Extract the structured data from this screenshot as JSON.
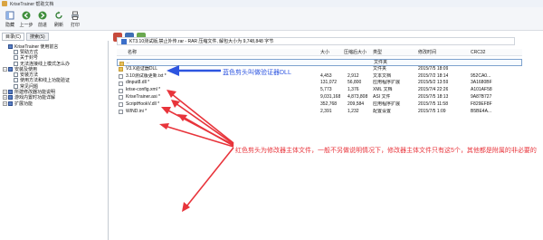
{
  "window": {
    "title": "KriseTrainer 帮助文档"
  },
  "toolbar": {
    "buttons": [
      {
        "label": "隐藏",
        "icon": "hide-icon"
      },
      {
        "label": "上一步",
        "icon": "back-icon"
      },
      {
        "label": "前进",
        "icon": "forward-icon"
      },
      {
        "label": "刷新",
        "icon": "refresh-icon"
      },
      {
        "label": "打印",
        "icon": "print-icon"
      }
    ]
  },
  "tabs": [
    "目录(C)",
    "搜索(S)"
  ],
  "tree": {
    "items": [
      {
        "label": "KriseTrainer 使用前言",
        "level": 1,
        "icon": "book"
      },
      {
        "label": "赞助方式",
        "level": 1,
        "icon": "page"
      },
      {
        "label": "关于封号",
        "level": 1,
        "icon": "page"
      },
      {
        "label": "无法连接线上模式怎么办",
        "level": 1,
        "icon": "page"
      },
      {
        "label": "安装及使用",
        "level": 0,
        "icon": "book"
      },
      {
        "label": "安装方法",
        "level": 1,
        "icon": "page"
      },
      {
        "label": "使用方法和线上功能验证",
        "level": 1,
        "icon": "page"
      },
      {
        "label": "常见问题",
        "level": 1,
        "icon": "page"
      },
      {
        "label": "所建修改器功能说明",
        "level": 0,
        "icon": "book"
      },
      {
        "label": "游戏内置时功能详解",
        "level": 0,
        "icon": "book"
      },
      {
        "label": "扩展功能",
        "level": 0,
        "icon": "book"
      }
    ]
  },
  "archive": {
    "path": "KT3.10测试版,禁止外传.rar - RAR 压缩文件, 解包大小为 9,748,848 字节",
    "columns": [
      "名称",
      "大小",
      "压缩后大小",
      "类型",
      "修改时间",
      "CRC32"
    ],
    "files": [
      {
        "name": "..",
        "size": "",
        "packed": "",
        "type": "文件夹",
        "modified": "",
        "crc": "",
        "icon": "folder"
      },
      {
        "name": "V3.X验证器DLL",
        "size": "",
        "packed": "",
        "type": "文件夹",
        "modified": "2015/7/5 18:09",
        "crc": "",
        "icon": "folder"
      },
      {
        "name": "3.10测试版更新.txt *",
        "size": "4,453",
        "packed": "2,912",
        "type": "文本文档",
        "modified": "2015/7/2 18:14",
        "crc": "952CA0...",
        "icon": "file"
      },
      {
        "name": "dinput8.dll *",
        "size": "131,072",
        "packed": "56,800",
        "type": "应用程序扩展",
        "modified": "2015/5/2 13:59",
        "crc": "3A1680BF",
        "icon": "file"
      },
      {
        "name": "krise-config.xml *",
        "size": "5,773",
        "packed": "1,376",
        "type": "XML 文档",
        "modified": "2015/7/4 22:26",
        "crc": "A101AF58",
        "icon": "file"
      },
      {
        "name": "KriseTrainer.asi *",
        "size": "9,031,168",
        "packed": "4,873,808",
        "type": "ASI 文件",
        "modified": "2015/7/5 18:13",
        "crc": "9A87B727",
        "icon": "file"
      },
      {
        "name": "ScriptHookV.dll *",
        "size": "352,768",
        "packed": "209,584",
        "type": "应用程序扩展",
        "modified": "2015/7/5 11:58",
        "crc": "F829EF8F",
        "icon": "file"
      },
      {
        "name": "WIND.ini *",
        "size": "2,391",
        "packed": "1,232",
        "type": "配置设置",
        "modified": "2015/7/5 1:09",
        "crc": "B5BE4A...",
        "icon": "file"
      }
    ]
  },
  "annotations": {
    "blue": "蓝色剪头叫做验证器DLL",
    "red": "红色剪头为修改器主体文件，一般不另做说明情况下，修改器主体文件只有这5个，其他都是附属的非必要的"
  },
  "colors": {
    "blue_arrow": "#2d55e0",
    "red_arrow": "#e8343b",
    "selection": "#7da2ce"
  }
}
